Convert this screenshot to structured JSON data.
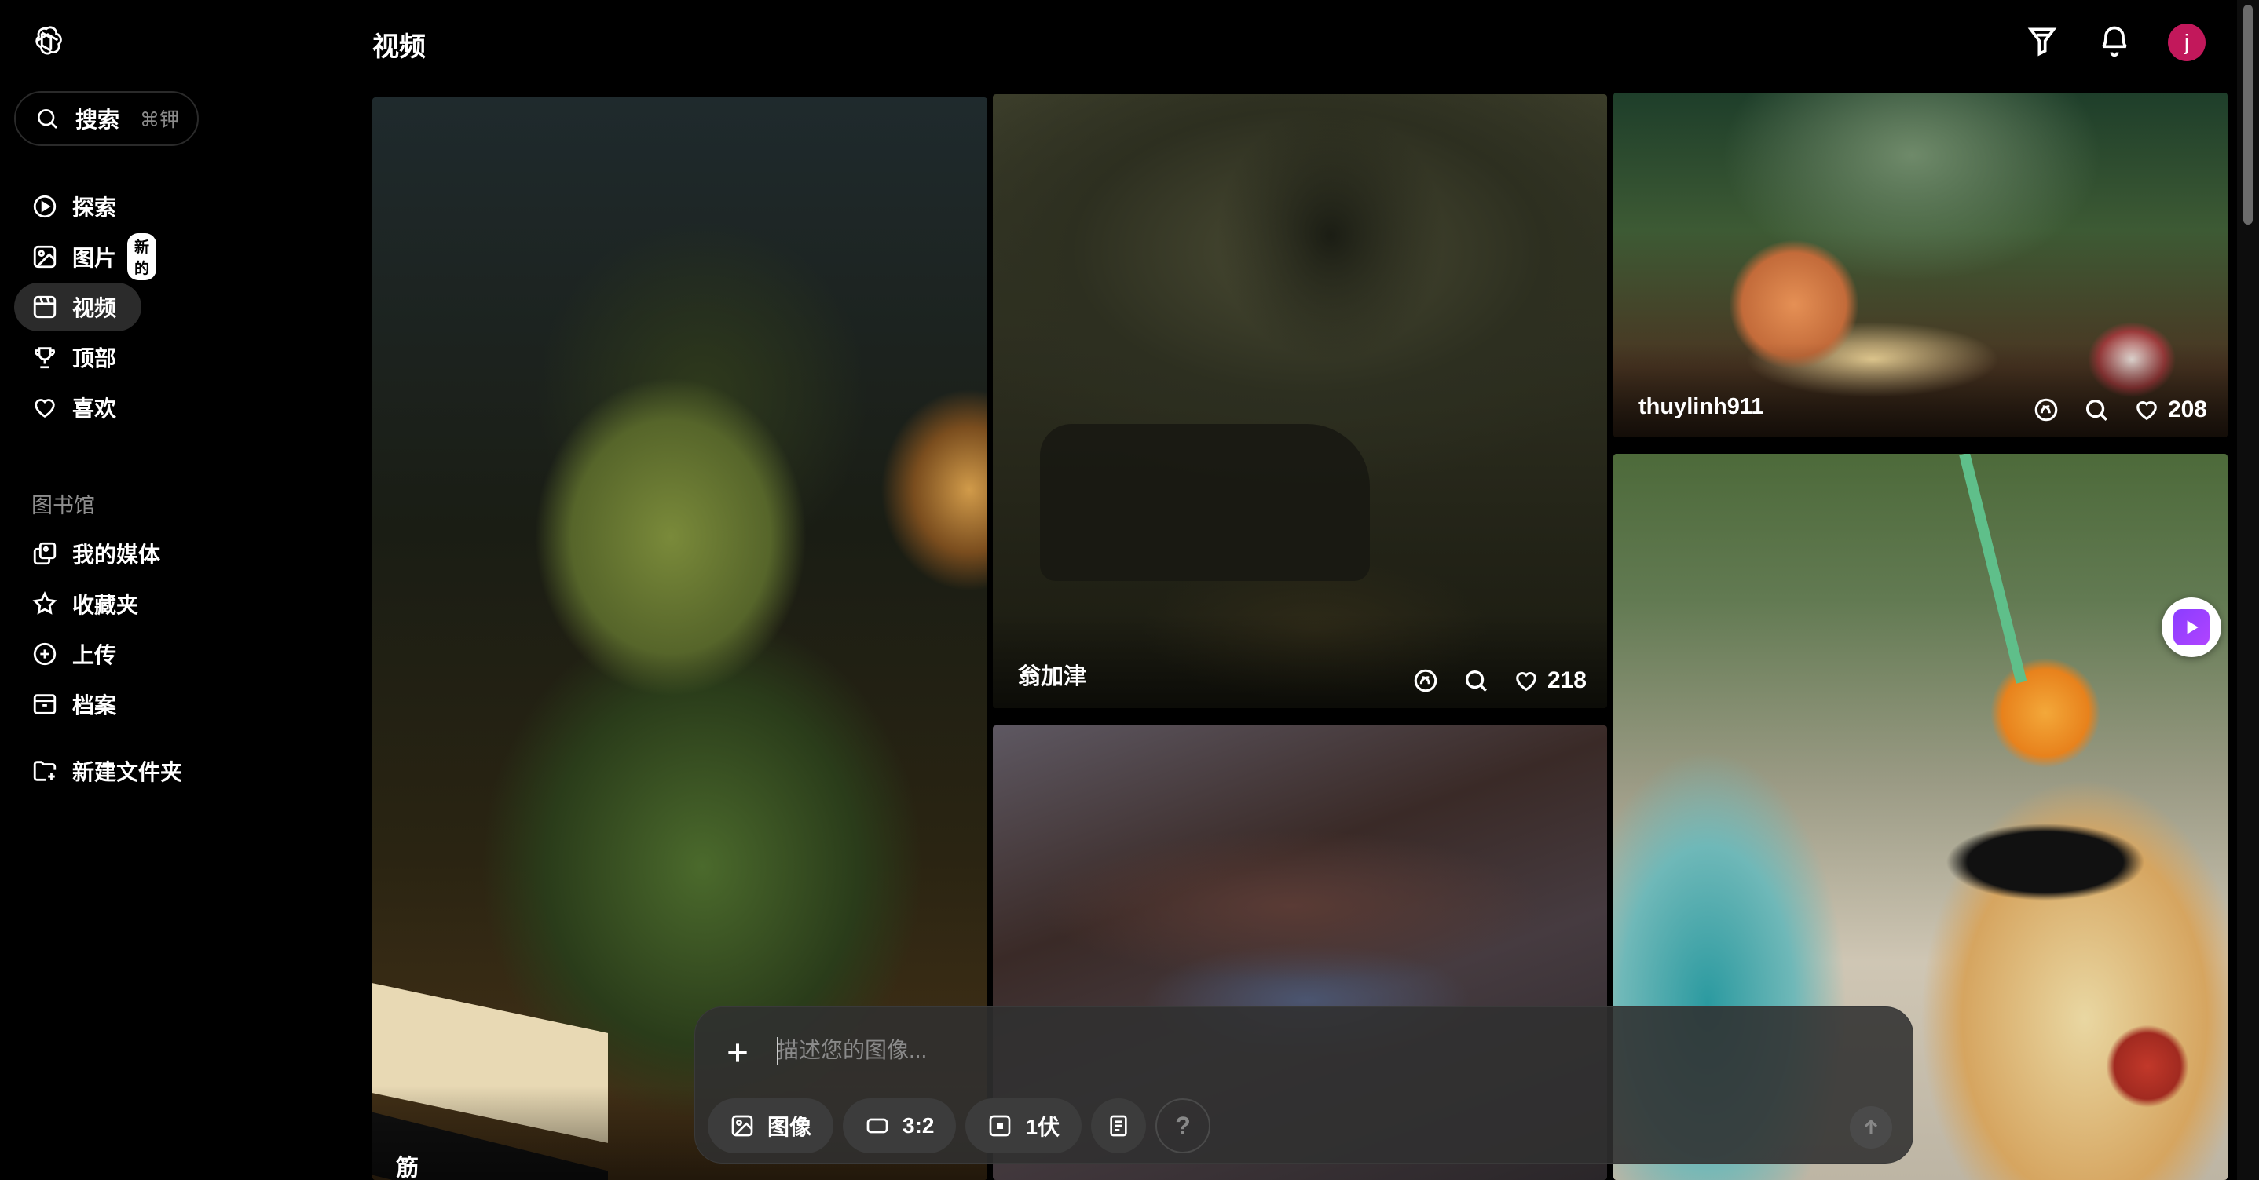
{
  "sidebar": {
    "search": {
      "label": "搜索",
      "shortcut": "⌘钾"
    },
    "nav": [
      {
        "label": "探索",
        "icon": "explore-icon"
      },
      {
        "label": "图片",
        "icon": "images-icon",
        "badge": "新的"
      },
      {
        "label": "视频",
        "icon": "video-icon",
        "active": true
      },
      {
        "label": "顶部",
        "icon": "trophy-icon"
      },
      {
        "label": "喜欢",
        "icon": "heart-icon"
      }
    ],
    "library_label": "图书馆",
    "library": [
      {
        "label": "我的媒体",
        "icon": "media-icon"
      },
      {
        "label": "收藏夹",
        "icon": "star-icon"
      },
      {
        "label": "上传",
        "icon": "upload-icon"
      },
      {
        "label": "档案",
        "icon": "archive-icon"
      }
    ],
    "new_folder": "新建文件夹"
  },
  "header": {
    "title": "视频",
    "avatar_letter": "j"
  },
  "cards": [
    {
      "author": "筋"
    },
    {
      "author": "翁加津",
      "likes": "218"
    },
    {
      "author": ""
    },
    {
      "author": "thuylinh911",
      "likes": "208"
    },
    {
      "author": ""
    }
  ],
  "composer": {
    "placeholder": "描述您的图像...",
    "chips": [
      {
        "label": "图像",
        "icon": "image-icon"
      },
      {
        "label": "3:2",
        "icon": "aspect-ratio-icon"
      },
      {
        "label": "1伏",
        "icon": "variants-icon"
      }
    ],
    "help": "?"
  },
  "colors": {
    "badge_bg": "#ffffff",
    "avatar": "#c2185b",
    "play_accent": "#8b3dff"
  }
}
